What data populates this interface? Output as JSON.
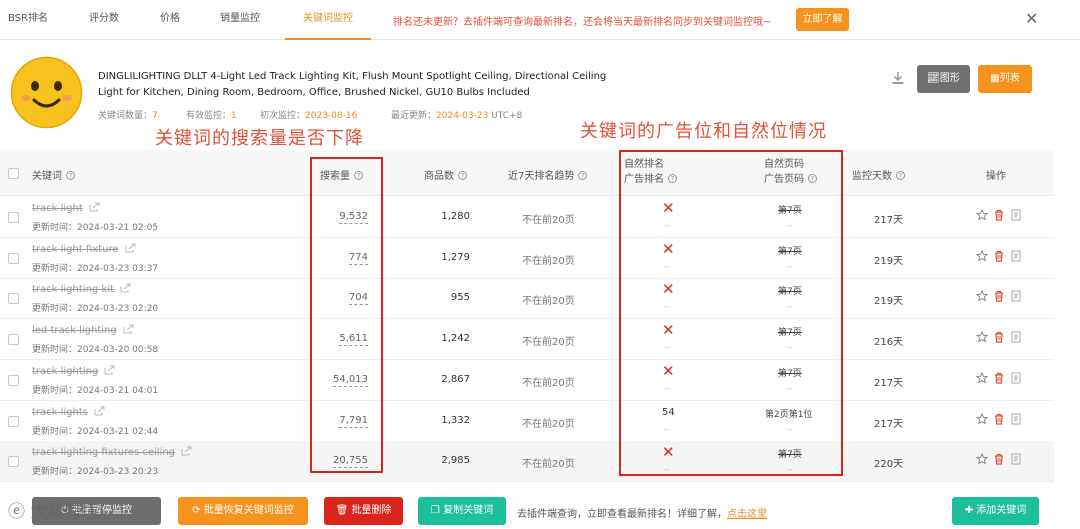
{
  "tabs": [
    {
      "label": "BSR排名"
    },
    {
      "label": "评分数"
    },
    {
      "label": "价格"
    },
    {
      "label": "销量监控"
    },
    {
      "label": "关键词监控"
    }
  ],
  "notice": {
    "text": "排名还未更新？去插件端可查询最新排名，还会将当天最新排名同步到关键词监控哦~",
    "button": "立即了解"
  },
  "product": {
    "title": "DINGLILIGHTING DLLT 4-Light Led Track Lighting Kit, Flush Mount Spotlight Ceiling, Directional Ceiling Light for Kitchen, Dining Room, Bedroom, Office, Brushed Nickel, GU10 Bulbs Included",
    "meta": [
      {
        "label": "关键词数量：",
        "value": "7"
      },
      {
        "label": "有效监控：",
        "value": "1"
      },
      {
        "label": "初次监控：",
        "value": "2023-08-16"
      },
      {
        "label": "最近更新：",
        "value": "2024-03-23",
        "suffix": "UTC+8"
      }
    ],
    "btn_chart": "图形",
    "btn_list": "列表"
  },
  "annotations": {
    "left": "关键词的搜索量是否下降",
    "right": "关键词的广告位和自然位情况"
  },
  "table": {
    "headers": {
      "keyword": "关键词",
      "volume": "搜索量",
      "goods": "商品数",
      "trend": "近7天排名趋势",
      "rank1": "自然排名",
      "rank2": "广告排名",
      "page1": "自然页码",
      "page2": "广告页码",
      "days": "监控天数",
      "ops": "操作"
    },
    "rows": [
      {
        "keyword": "track light",
        "updated": "更新时间：2024-03-21 02:05",
        "volume": "9,532",
        "goods": "1,280",
        "trend": "不在前20页",
        "nat": "x",
        "ad": "--",
        "page": "第7页",
        "page_strike": true,
        "adpage": "--",
        "days": "217天"
      },
      {
        "keyword": "track light fixture",
        "updated": "更新时间：2024-03-23 03:37",
        "volume": "774",
        "goods": "1,279",
        "trend": "不在前20页",
        "nat": "x",
        "ad": "--",
        "page": "第7页",
        "page_strike": true,
        "adpage": "--",
        "days": "219天"
      },
      {
        "keyword": "track lighting kit",
        "updated": "更新时间：2024-03-23 02:20",
        "volume": "704",
        "goods": "955",
        "trend": "不在前20页",
        "nat": "x",
        "ad": "--",
        "page": "第7页",
        "page_strike": true,
        "adpage": "--",
        "days": "219天"
      },
      {
        "keyword": "led track lighting",
        "updated": "更新时间：2024-03-20 00:58",
        "volume": "5,611",
        "goods": "1,242",
        "trend": "不在前20页",
        "nat": "x",
        "ad": "--",
        "page": "第7页",
        "page_strike": true,
        "adpage": "--",
        "days": "216天"
      },
      {
        "keyword": "track lighting",
        "updated": "更新时间：2024-03-21 04:01",
        "volume": "54,013",
        "goods": "2,867",
        "trend": "不在前20页",
        "nat": "x",
        "ad": "--",
        "page": "第7页",
        "page_strike": true,
        "adpage": "--",
        "days": "217天"
      },
      {
        "keyword": "track lights",
        "updated": "更新时间：2024-03-21 02:44",
        "volume": "7,791",
        "goods": "1,332",
        "trend": "不在前20页",
        "nat": "54",
        "ad": "--",
        "page": "第2页第1位",
        "page_strike": false,
        "adpage": "--",
        "days": "217天"
      },
      {
        "keyword": "track lighting fixtures ceiling",
        "updated": "更新时间：2024-03-23 20:23",
        "volume": "20,755",
        "goods": "2,985",
        "trend": "不在前20页",
        "nat": "x",
        "ad": "--",
        "page": "第7页",
        "page_strike": true,
        "adpage": "--",
        "days": "220天"
      }
    ]
  },
  "footer": {
    "btn_stop": "批量暂停监控",
    "btn_restore": "批量恢复关键词监控",
    "btn_delete": "批量删除",
    "btn_copy": "复制关键词",
    "hint": "去插件端查询，立即查看最新排名！详细了解，",
    "link": "点击这里",
    "btn_add": "添加关键词",
    "watermark": "大数跨境"
  },
  "colors": {
    "accent": "#f6921e",
    "red": "#d9251c",
    "teal": "#1bbf9a",
    "gray": "#707070"
  }
}
